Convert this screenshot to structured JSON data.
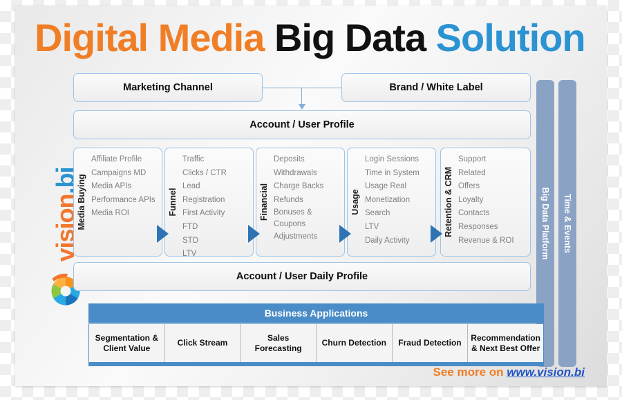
{
  "title": {
    "part1": "Digital Media ",
    "part2": "Big Data ",
    "part3": "Solution",
    "color1": "#F07E26",
    "color2": "#111111",
    "color3": "#2B93D1"
  },
  "brand": {
    "name_part1": "vision",
    "name_part2": ".bi",
    "icon": "aperture-icon",
    "color1": "#F2762E",
    "color2": "#2B93D1"
  },
  "top_boxes": {
    "marketing_channel": "Marketing Channel",
    "brand_white_label": "Brand / White  Label",
    "account_user_profile": "Account / User Profile"
  },
  "columns": [
    {
      "title": "Media Buying",
      "items": [
        "Affiliate Profile",
        "Campaigns MD",
        "Media APIs",
        "Performance APIs",
        "Media ROI"
      ]
    },
    {
      "title": "Funnel",
      "items": [
        "Traffic",
        "Clicks / CTR",
        "Lead",
        "Registration",
        "First Activity",
        "FTD",
        "STD",
        "LTV"
      ]
    },
    {
      "title": "Financial",
      "items": [
        "Deposits",
        "Withdrawals",
        "Charge Backs",
        "Refunds",
        "Bonuses & Coupons",
        "Adjustments"
      ]
    },
    {
      "title": "Usage",
      "items": [
        "Login Sessions",
        "Time in System",
        "Usage Real",
        "Monetization",
        "Search",
        "LTV",
        "Daily Activity"
      ]
    },
    {
      "title": "Retention & CRM",
      "items": [
        "Support",
        "Related",
        "Offers",
        "Loyalty",
        "Contacts",
        "Responses",
        "Revenue & ROI"
      ]
    }
  ],
  "vertical_bars": [
    {
      "label": "Big Data Platform",
      "color": "#8AA2C4"
    },
    {
      "label": "Time & Events",
      "color": "#8AA2C4"
    }
  ],
  "daily_profile": "Account / User  Daily Profile",
  "business_applications": {
    "header": "Business Applications",
    "header_color": "#4A8CC7",
    "cells": [
      "Segmentation & Client Value",
      "Click Stream",
      "Sales Forecasting",
      "Churn Detection",
      "Fraud Detection",
      "Recommendation & Next Best Offer"
    ]
  },
  "footer": {
    "see_more": "See more on ",
    "url": "www.vision.bi"
  }
}
